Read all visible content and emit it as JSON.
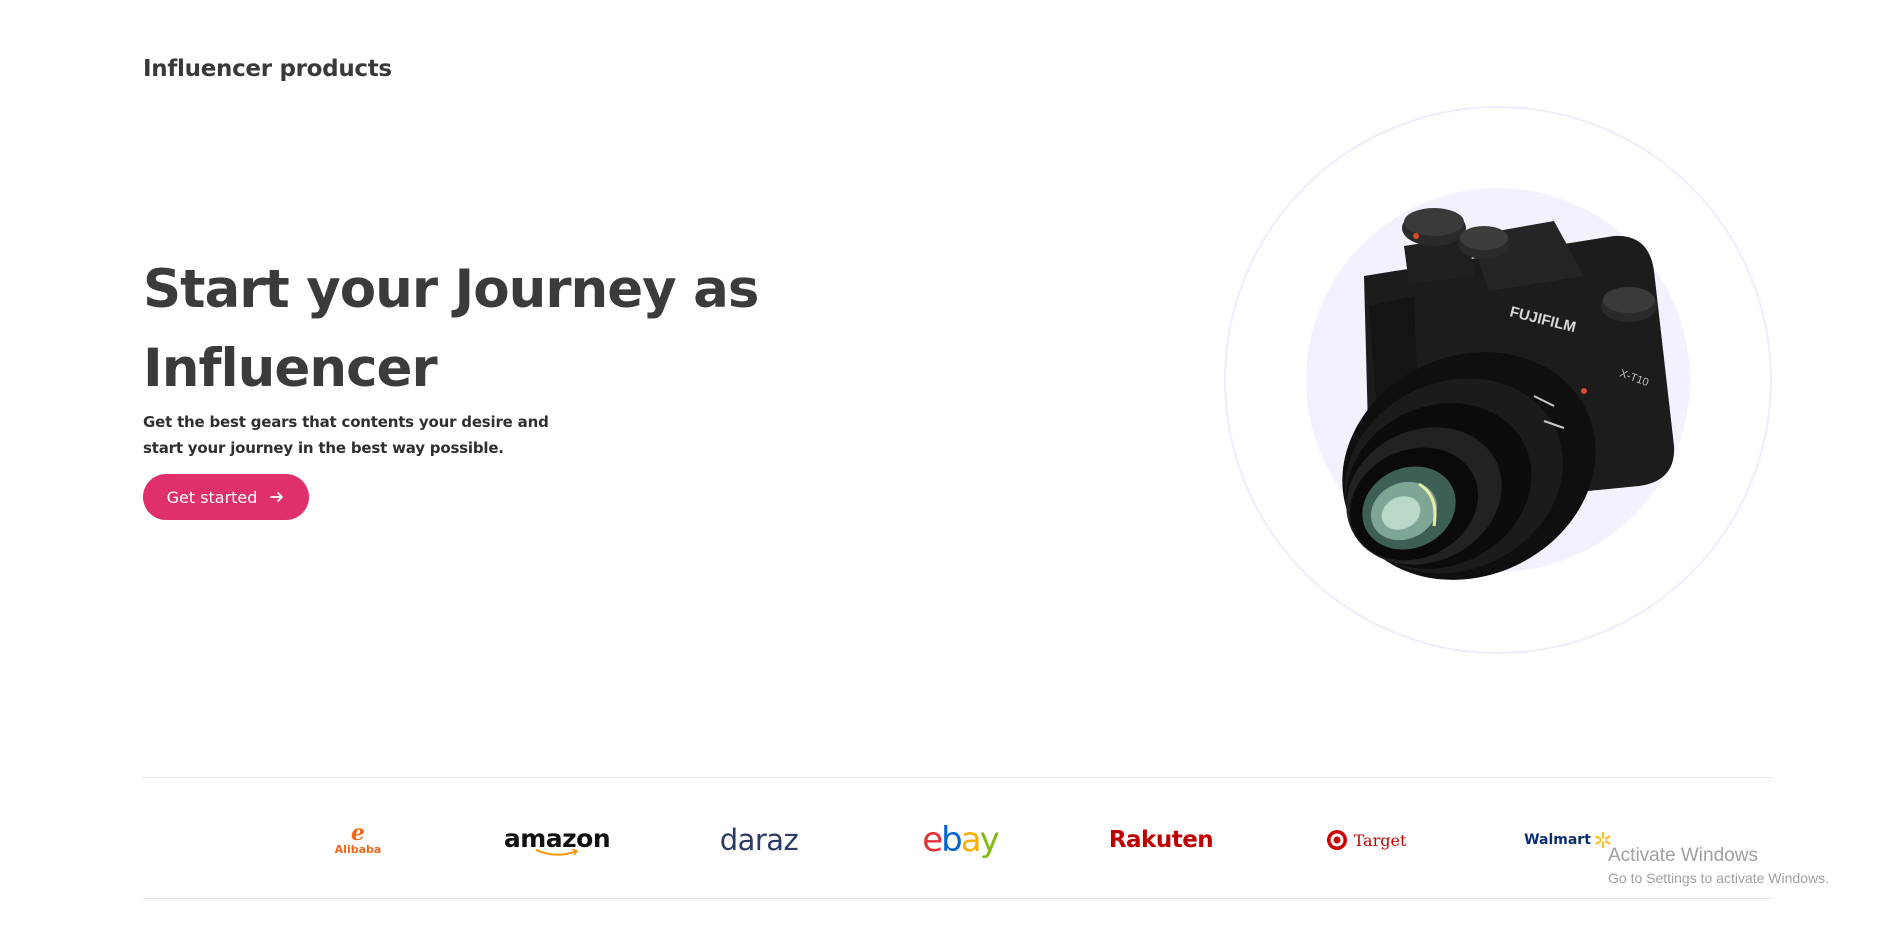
{
  "brand": {
    "name": "Influencer products"
  },
  "hero": {
    "title": "Start your Journey as Influencer",
    "subtitle": "Get the best gears that contents your desire and start your journey in the best way possible.",
    "cta_label": "Get started",
    "cta_icon": "arrow-right-icon",
    "image": {
      "subject": "camera-icon",
      "brand_text": "FUJIFILM",
      "model_text": "X-T10"
    }
  },
  "partners": [
    {
      "name": "Alibaba",
      "icon": "alibaba-logo-icon",
      "color": "#f0671e"
    },
    {
      "name": "amazon",
      "icon": "amazon-logo-icon",
      "color": "#111111"
    },
    {
      "name": "daraz",
      "icon": "daraz-logo-icon",
      "color": "#2b3a67"
    },
    {
      "name": "ebay",
      "icon": "ebay-logo-icon",
      "colors": [
        "#e53238",
        "#0064d2",
        "#f5af02",
        "#86b817"
      ]
    },
    {
      "name": "Rakuten",
      "icon": "rakuten-logo-icon",
      "color": "#bf0000"
    },
    {
      "name": "Target",
      "icon": "target-logo-icon",
      "color": "#cc0000"
    },
    {
      "name": "Walmart",
      "icon": "walmart-logo-icon",
      "color": "#0b2d74"
    }
  ],
  "system_overlay": {
    "title": "Activate Windows",
    "subtitle": "Go to Settings to activate Windows."
  },
  "colors": {
    "accent": "#e0306a",
    "heading": "#3b3b3b",
    "disc": "#f5f0fe"
  }
}
